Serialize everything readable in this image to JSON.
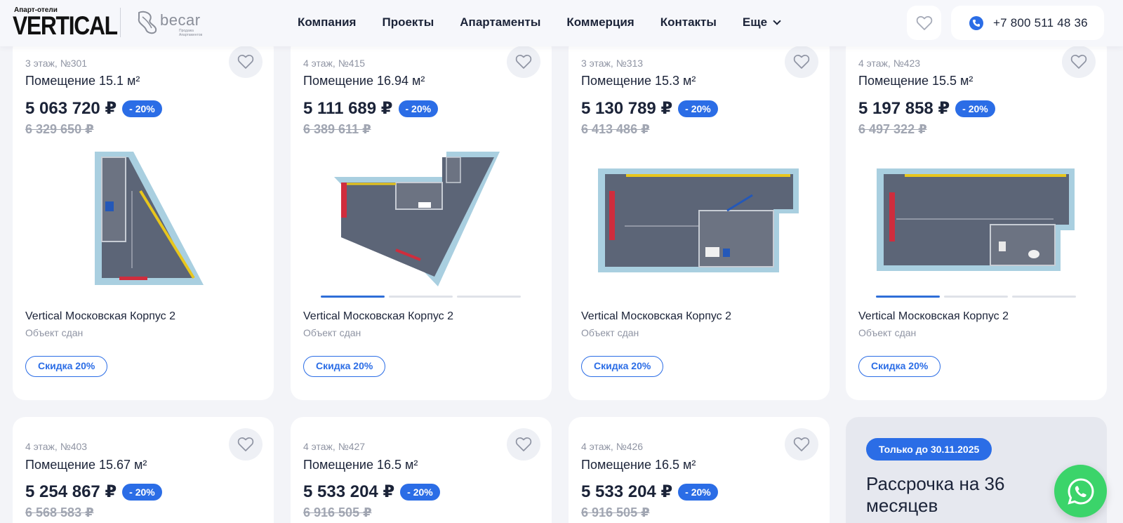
{
  "header": {
    "logo_small": "Апарт-отели",
    "logo_main": "VERTICAL",
    "partner_name": "becar",
    "partner_sub": "Продажа Апартаментов",
    "nav": [
      "Компания",
      "Проекты",
      "Апартаменты",
      "Коммерция",
      "Контакты"
    ],
    "nav_more": "Еще",
    "phone": "+7 800 511 48 36"
  },
  "cards": [
    {
      "floor": "3 этаж, №301",
      "title": "Помещение 15.1 м²",
      "price": "5 063 720 ₽",
      "badge": "- 20%",
      "old_price": "6 329 650 ₽",
      "project": "Vertical Московская Корпус 2",
      "status": "Объект сдан",
      "tag": "Скидка 20%"
    },
    {
      "floor": "4 этаж, №415",
      "title": "Помещение 16.94 м²",
      "price": "5 111 689 ₽",
      "badge": "- 20%",
      "old_price": "6 389 611 ₽",
      "project": "Vertical Московская Корпус 2",
      "status": "Объект сдан",
      "tag": "Скидка 20%"
    },
    {
      "floor": "3 этаж, №313",
      "title": "Помещение 15.3 м²",
      "price": "5 130 789 ₽",
      "badge": "- 20%",
      "old_price": "6 413 486 ₽",
      "project": "Vertical Московская Корпус 2",
      "status": "Объект сдан",
      "tag": "Скидка 20%"
    },
    {
      "floor": "4 этаж, №423",
      "title": "Помещение 15.5 м²",
      "price": "5 197 858 ₽",
      "badge": "- 20%",
      "old_price": "6 497 322 ₽",
      "project": "Vertical Московская Корпус 2",
      "status": "Объект сдан",
      "tag": "Скидка 20%"
    },
    {
      "floor": "4 этаж, №403",
      "title": "Помещение 15.67 м²",
      "price": "5 254 867 ₽",
      "badge": "- 20%",
      "old_price": "6 568 583 ₽"
    },
    {
      "floor": "4 этаж, №427",
      "title": "Помещение 16.5 м²",
      "price": "5 533 204 ₽",
      "badge": "- 20%",
      "old_price": "6 916 505 ₽"
    },
    {
      "floor": "4 этаж, №426",
      "title": "Помещение 16.5 м²",
      "price": "5 533 204 ₽",
      "badge": "- 20%",
      "old_price": "6 916 505 ₽"
    }
  ],
  "promo": {
    "badge": "Только до 30.11.2025",
    "title": "Рассрочка на 36 месяцев"
  },
  "colors": {
    "accent": "#2b6de6",
    "whatsapp": "#3bd46a",
    "old_price": "#a1a6b2"
  }
}
